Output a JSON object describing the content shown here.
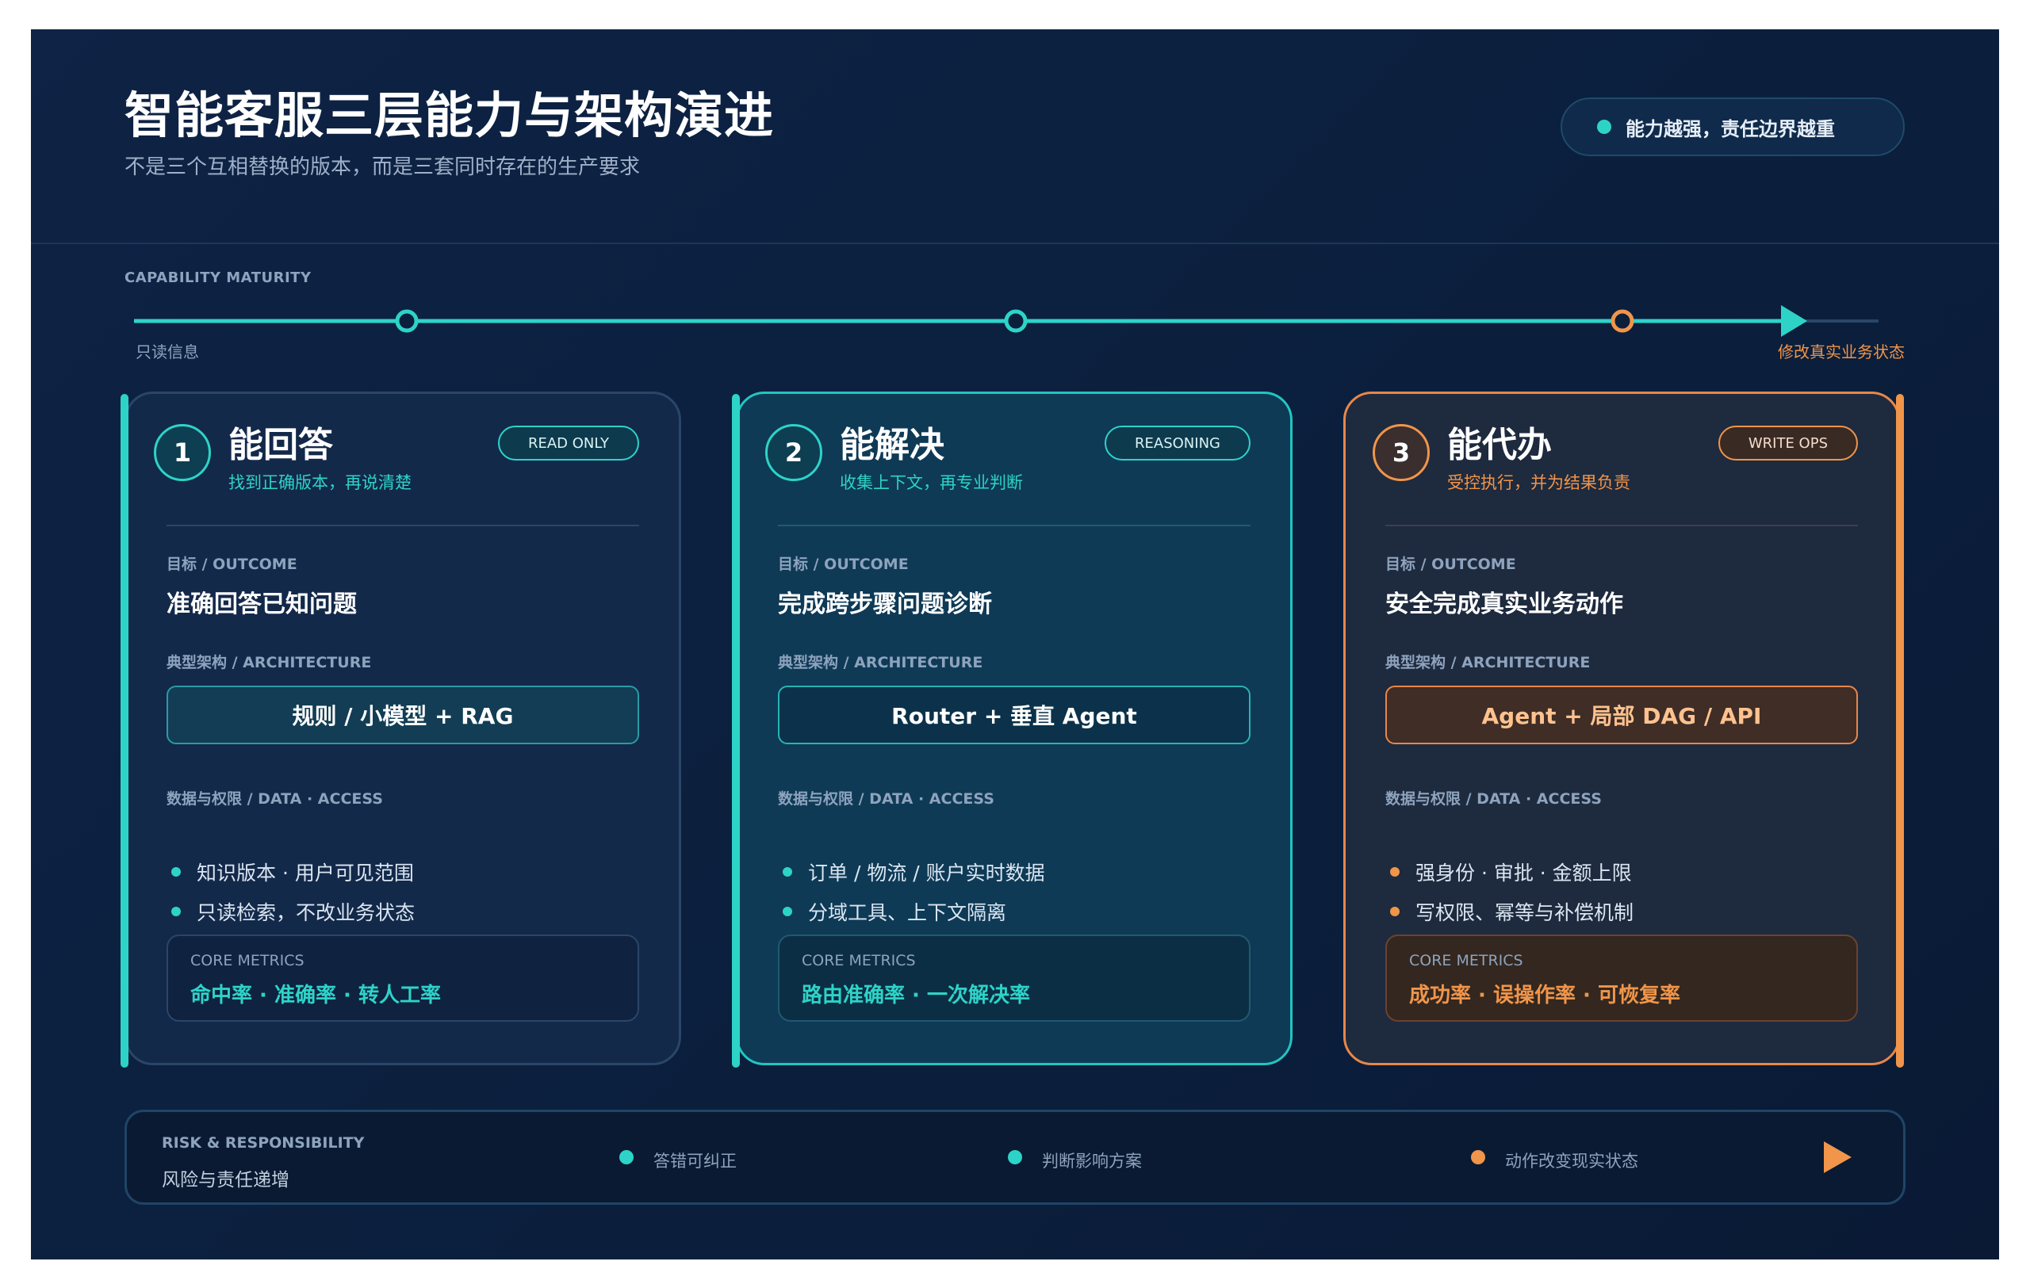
{
  "header": {
    "title": "智能客服三层能力与架构演进",
    "subtitle": "不是三个互相替换的版本，而是三套同时存在的生产要求",
    "pill": "能力越强，责任边界越重"
  },
  "maturity": {
    "label": "CAPABILITY MATURITY",
    "left": "只读信息",
    "right": "修改真实业务状态"
  },
  "cards": [
    {
      "number": "1",
      "title": "能回答",
      "subtitle": "找到正确版本，再说清楚",
      "badge": "READ ONLY",
      "goal_label": "目标 / OUTCOME",
      "goal": "准确回答已知问题",
      "arch_label": "典型架构 / ARCHITECTURE",
      "arch": "规则 / 小模型 + RAG",
      "data_label": "数据与权限 / DATA · ACCESS",
      "bullets": [
        "知识版本 · 用户可见范围",
        "只读检索，不改业务状态"
      ],
      "metrics_label": "CORE METRICS",
      "metrics": "命中率 · 准确率 · 转人工率"
    },
    {
      "number": "2",
      "title": "能解决",
      "subtitle": "收集上下文，再专业判断",
      "badge": "REASONING",
      "goal_label": "目标 / OUTCOME",
      "goal": "完成跨步骤问题诊断",
      "arch_label": "典型架构 / ARCHITECTURE",
      "arch": "Router + 垂直 Agent",
      "data_label": "数据与权限 / DATA · ACCESS",
      "bullets": [
        "订单 / 物流 / 账户实时数据",
        "分域工具、上下文隔离"
      ],
      "metrics_label": "CORE METRICS",
      "metrics": "路由准确率 · 一次解决率"
    },
    {
      "number": "3",
      "title": "能代办",
      "subtitle": "受控执行，并为结果负责",
      "badge": "WRITE OPS",
      "goal_label": "目标 / OUTCOME",
      "goal": "安全完成真实业务动作",
      "arch_label": "典型架构 / ARCHITECTURE",
      "arch": "Agent + 局部 DAG / API",
      "data_label": "数据与权限 / DATA · ACCESS",
      "bullets": [
        "强身份 · 审批 · 金额上限",
        "写权限、幂等与补偿机制"
      ],
      "metrics_label": "CORE METRICS",
      "metrics": "成功率 · 误操作率 · 可恢复率"
    }
  ],
  "risk": {
    "label": "RISK & RESPONSIBILITY",
    "subtitle": "风险与责任递增",
    "items": [
      "答错可纠正",
      "判断影响方案",
      "动作改变现实状态"
    ]
  },
  "colors": {
    "background": "#0b1f3d",
    "teal": "#2ed3c8",
    "orange": "#f0954a"
  }
}
